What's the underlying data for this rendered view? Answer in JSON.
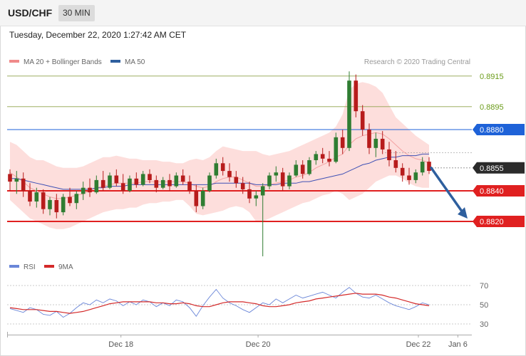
{
  "header": {
    "symbol": "USD/CHF",
    "timeframe": "30 MIN",
    "datetime": "Tuesday, December 22, 2020 1:27:42 AM CET"
  },
  "legend": {
    "ma20_bollinger": "MA 20 + Bollinger Bands",
    "ma50": "MA 50",
    "credit": "Research © 2020 Trading Central",
    "rsi": "RSI",
    "rsi_ma": "9MA"
  },
  "colors": {
    "bull_candle": "#2f7d32",
    "bear_candle": "#b71c1c",
    "bollinger_fill": "#fdd8d6",
    "ma20": "#f3a3a3",
    "ma50": "#3f51b5",
    "resistance_blue": "#1e62d8",
    "support_red": "#e02020",
    "target_green_lines": "#8fa34b",
    "last_price_box": "#2b2b2b",
    "forecast_arrow": "#2e5f9e",
    "rsi_line": "#6a86d8",
    "rsi_ma_line": "#d42a2a"
  },
  "chart_data": [
    {
      "type": "candlestick",
      "price_levels": [
        {
          "value": "0.8915",
          "kind": "target",
          "color": "#6b9c1a"
        },
        {
          "value": "0.8895",
          "kind": "target",
          "color": "#6b9c1a"
        },
        {
          "value": "0.8880",
          "kind": "resistance",
          "color": "#1e62d8"
        },
        {
          "value": "0.8855",
          "kind": "last",
          "color": "#2b2b2b"
        },
        {
          "value": "0.8840",
          "kind": "support",
          "color": "#e02020"
        },
        {
          "value": "0.8820",
          "kind": "support",
          "color": "#e02020"
        }
      ],
      "y_range": [
        0.879,
        0.8925
      ],
      "ohlc": [
        [
          0.8851,
          0.8854,
          0.884,
          0.8846
        ],
        [
          0.8846,
          0.8853,
          0.8838,
          0.8848
        ],
        [
          0.8848,
          0.8852,
          0.8836,
          0.884
        ],
        [
          0.884,
          0.8845,
          0.883,
          0.8833
        ],
        [
          0.8833,
          0.8842,
          0.8829,
          0.8839
        ],
        [
          0.8839,
          0.8841,
          0.8825,
          0.8828
        ],
        [
          0.8828,
          0.8836,
          0.8824,
          0.8834
        ],
        [
          0.8834,
          0.8838,
          0.8822,
          0.8826
        ],
        [
          0.8826,
          0.8838,
          0.8824,
          0.8836
        ],
        [
          0.8836,
          0.8842,
          0.883,
          0.8832
        ],
        [
          0.8832,
          0.884,
          0.8828,
          0.8838
        ],
        [
          0.8838,
          0.8846,
          0.8834,
          0.8842
        ],
        [
          0.8842,
          0.8848,
          0.8836,
          0.8839
        ],
        [
          0.8839,
          0.885,
          0.8838,
          0.8847
        ],
        [
          0.8847,
          0.8853,
          0.884,
          0.8842
        ],
        [
          0.8842,
          0.8852,
          0.8841,
          0.885
        ],
        [
          0.885,
          0.8854,
          0.8843,
          0.8845
        ],
        [
          0.8845,
          0.8851,
          0.8838,
          0.884
        ],
        [
          0.884,
          0.885,
          0.8839,
          0.8848
        ],
        [
          0.8848,
          0.8852,
          0.8842,
          0.8844
        ],
        [
          0.8844,
          0.8853,
          0.8843,
          0.8851
        ],
        [
          0.8851,
          0.8854,
          0.8845,
          0.8847
        ],
        [
          0.8847,
          0.885,
          0.8839,
          0.8842
        ],
        [
          0.8842,
          0.8849,
          0.8841,
          0.8847
        ],
        [
          0.8847,
          0.8851,
          0.884,
          0.8843
        ],
        [
          0.8843,
          0.8852,
          0.8842,
          0.885
        ],
        [
          0.885,
          0.8854,
          0.8844,
          0.8846
        ],
        [
          0.8846,
          0.885,
          0.8838,
          0.884
        ],
        [
          0.884,
          0.8844,
          0.8826,
          0.883
        ],
        [
          0.883,
          0.8842,
          0.8828,
          0.884
        ],
        [
          0.884,
          0.8852,
          0.8839,
          0.885
        ],
        [
          0.885,
          0.8861,
          0.8848,
          0.8858
        ],
        [
          0.8858,
          0.8862,
          0.885,
          0.8853
        ],
        [
          0.8853,
          0.8858,
          0.8846,
          0.8849
        ],
        [
          0.8849,
          0.8853,
          0.8842,
          0.8845
        ],
        [
          0.8845,
          0.8849,
          0.8838,
          0.8841
        ],
        [
          0.8841,
          0.8846,
          0.8832,
          0.8835
        ],
        [
          0.8835,
          0.884,
          0.883,
          0.8837
        ],
        [
          0.8837,
          0.8845,
          0.8795,
          0.8843
        ],
        [
          0.8843,
          0.8852,
          0.8841,
          0.885
        ],
        [
          0.885,
          0.8856,
          0.8846,
          0.8852
        ],
        [
          0.8852,
          0.8855,
          0.884,
          0.8843
        ],
        [
          0.8843,
          0.8852,
          0.8841,
          0.885
        ],
        [
          0.885,
          0.886,
          0.8849,
          0.8857
        ],
        [
          0.8857,
          0.886,
          0.8848,
          0.8851
        ],
        [
          0.8851,
          0.8862,
          0.885,
          0.886
        ],
        [
          0.886,
          0.8866,
          0.8857,
          0.8864
        ],
        [
          0.8864,
          0.8868,
          0.8858,
          0.8861
        ],
        [
          0.8861,
          0.8866,
          0.8856,
          0.8859
        ],
        [
          0.8859,
          0.8878,
          0.8858,
          0.8875
        ],
        [
          0.8875,
          0.888,
          0.8864,
          0.8868
        ],
        [
          0.8868,
          0.8918,
          0.8866,
          0.8912
        ],
        [
          0.8912,
          0.8916,
          0.8888,
          0.8892
        ],
        [
          0.8892,
          0.8896,
          0.8876,
          0.888
        ],
        [
          0.888,
          0.8884,
          0.8864,
          0.8868
        ],
        [
          0.8868,
          0.8878,
          0.8862,
          0.8874
        ],
        [
          0.8874,
          0.8879,
          0.8864,
          0.8867
        ],
        [
          0.8867,
          0.8872,
          0.8856,
          0.886
        ],
        [
          0.886,
          0.8866,
          0.8852,
          0.8855
        ],
        [
          0.8855,
          0.8858,
          0.8846,
          0.885
        ],
        [
          0.885,
          0.8855,
          0.8844,
          0.8847
        ],
        [
          0.8847,
          0.8854,
          0.8845,
          0.8852
        ],
        [
          0.8852,
          0.8862,
          0.885,
          0.8859
        ],
        [
          0.8859,
          0.8862,
          0.8851,
          0.8853
        ]
      ],
      "ma20": [
        0.8852,
        0.8849,
        0.8846,
        0.8842,
        0.884,
        0.8838,
        0.8836,
        0.8835,
        0.8835,
        0.8836,
        0.8837,
        0.8838,
        0.884,
        0.8842,
        0.8843,
        0.8844,
        0.8845,
        0.8845,
        0.8845,
        0.8845,
        0.8846,
        0.8846,
        0.8846,
        0.8846,
        0.8846,
        0.8846,
        0.8846,
        0.8845,
        0.8843,
        0.8842,
        0.8843,
        0.8846,
        0.8848,
        0.8849,
        0.8849,
        0.8847,
        0.8845,
        0.8843,
        0.8843,
        0.8844,
        0.8845,
        0.8846,
        0.8847,
        0.8849,
        0.885,
        0.8852,
        0.8855,
        0.8857,
        0.8859,
        0.8862,
        0.8864,
        0.887,
        0.8874,
        0.8876,
        0.8877,
        0.8878,
        0.8877,
        0.8874,
        0.887,
        0.8866,
        0.8863,
        0.8861,
        0.886,
        0.8858
      ],
      "ma50": [
        0.8848,
        0.8848,
        0.8847,
        0.8846,
        0.8845,
        0.8844,
        0.8843,
        0.8842,
        0.8841,
        0.8841,
        0.8841,
        0.8841,
        0.8841,
        0.8842,
        0.8842,
        0.8843,
        0.8843,
        0.8843,
        0.8844,
        0.8844,
        0.8844,
        0.8844,
        0.8844,
        0.8844,
        0.8844,
        0.8844,
        0.8844,
        0.8844,
        0.8844,
        0.8844,
        0.8844,
        0.8845,
        0.8845,
        0.8845,
        0.8845,
        0.8845,
        0.8845,
        0.8844,
        0.8844,
        0.8844,
        0.8844,
        0.8845,
        0.8845,
        0.8845,
        0.8846,
        0.8846,
        0.8847,
        0.8848,
        0.8849,
        0.885,
        0.8851,
        0.8853,
        0.8855,
        0.8857,
        0.8858,
        0.886,
        0.8861,
        0.8862,
        0.8862,
        0.8863,
        0.8863,
        0.8863,
        0.8864,
        0.8864
      ],
      "bb_upper": [
        0.8872,
        0.887,
        0.8866,
        0.8862,
        0.886,
        0.886,
        0.8858,
        0.8856,
        0.8855,
        0.8855,
        0.8855,
        0.8856,
        0.8858,
        0.886,
        0.8862,
        0.8862,
        0.8863,
        0.8862,
        0.8861,
        0.8861,
        0.886,
        0.886,
        0.886,
        0.8859,
        0.8859,
        0.8858,
        0.8858,
        0.886,
        0.8861,
        0.886,
        0.8862,
        0.8866,
        0.8869,
        0.8868,
        0.8867,
        0.8866,
        0.8866,
        0.8866,
        0.8864,
        0.8863,
        0.8864,
        0.8865,
        0.8866,
        0.8868,
        0.887,
        0.8872,
        0.8874,
        0.8876,
        0.8878,
        0.8882,
        0.889,
        0.8906,
        0.891,
        0.8911,
        0.891,
        0.8908,
        0.8904,
        0.8896,
        0.8888,
        0.8884,
        0.888,
        0.8876,
        0.8873,
        0.887
      ],
      "bb_lower": [
        0.8834,
        0.883,
        0.8826,
        0.8822,
        0.882,
        0.8818,
        0.8816,
        0.8815,
        0.8815,
        0.8816,
        0.8818,
        0.882,
        0.8822,
        0.8824,
        0.8826,
        0.8827,
        0.8828,
        0.8828,
        0.8829,
        0.8829,
        0.8831,
        0.8832,
        0.8832,
        0.8833,
        0.8833,
        0.8834,
        0.8834,
        0.883,
        0.8825,
        0.8824,
        0.8825,
        0.8826,
        0.8827,
        0.8829,
        0.883,
        0.8829,
        0.8826,
        0.882,
        0.882,
        0.8822,
        0.8824,
        0.8826,
        0.8828,
        0.883,
        0.8832,
        0.8833,
        0.8835,
        0.8837,
        0.8838,
        0.884,
        0.8838,
        0.8834,
        0.8836,
        0.8838,
        0.8842,
        0.8846,
        0.8848,
        0.885,
        0.885,
        0.8848,
        0.8845,
        0.8843,
        0.8842,
        0.8842
      ],
      "forecast": {
        "from_value": 0.8855,
        "to_value": 0.882
      }
    },
    {
      "type": "line",
      "y_ticks": [
        "70",
        "50",
        "30"
      ],
      "y_range": [
        25,
        75
      ],
      "x_ticks": [
        {
          "label": "Dec 18",
          "pos": 0.245
        },
        {
          "label": "Dec 20",
          "pos": 0.54
        },
        {
          "label": "Dec 22",
          "pos": 0.885
        },
        {
          "label": "Jan 6",
          "pos": 0.97
        }
      ],
      "series": [
        {
          "name": "RSI",
          "values": [
            46,
            44,
            42,
            47,
            45,
            40,
            39,
            43,
            37,
            41,
            47,
            52,
            50,
            55,
            52,
            56,
            54,
            49,
            53,
            50,
            55,
            53,
            48,
            52,
            49,
            55,
            53,
            47,
            38,
            49,
            58,
            66,
            57,
            52,
            49,
            45,
            42,
            47,
            52,
            50,
            56,
            52,
            56,
            60,
            57,
            59,
            61,
            63,
            60,
            57,
            63,
            68,
            62,
            58,
            57,
            60,
            56,
            52,
            49,
            47,
            45,
            48,
            52,
            50
          ]
        },
        {
          "name": "9MA",
          "values": [
            47,
            46,
            45,
            45,
            45,
            44,
            43,
            43,
            42,
            41,
            42,
            43,
            45,
            47,
            49,
            51,
            52,
            53,
            53,
            53,
            53,
            53,
            52,
            52,
            51,
            51,
            52,
            51,
            49,
            48,
            48,
            50,
            52,
            53,
            53,
            53,
            52,
            51,
            49,
            48,
            48,
            49,
            50,
            52,
            53,
            54,
            56,
            57,
            58,
            59,
            60,
            61,
            62,
            61,
            61,
            61,
            60,
            58,
            57,
            55,
            53,
            51,
            50,
            49
          ]
        }
      ]
    }
  ]
}
